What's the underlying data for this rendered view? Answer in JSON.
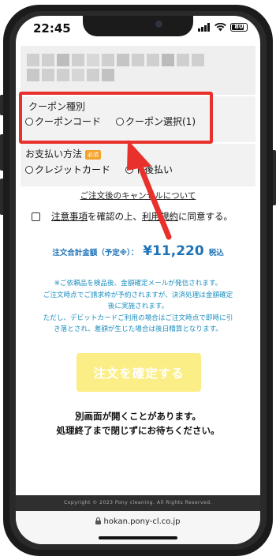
{
  "status": {
    "time": "22:45",
    "battery": "80"
  },
  "coupon": {
    "title": "クーポン種別",
    "options": [
      "クーポンコード",
      "クーポン選択(1)"
    ]
  },
  "payment": {
    "title": "お支払い方法",
    "badge": "必須",
    "options": [
      "クレジットカード",
      "後払い"
    ],
    "option2_prefix": "ト"
  },
  "cancel_link": "ご注文後のキャンセルについて",
  "agreement": {
    "link1": "注意事項",
    "text1": "を確認の上、",
    "link2": "利用規約",
    "text2": "に同意する。"
  },
  "total": {
    "label": "注文合計金額（予定※）：",
    "amount": "¥11,220",
    "tax": "税込"
  },
  "notice": [
    "※ご依頼品を検品後、金額確定メールが発信されます。",
    "ご注文時点でご請求枠が予約されますが、決済処理は金額確定",
    "後に実施されます。",
    "ただし、デビットカードご利用の場合はご注文時点で即時に引",
    "き落とされ、差額が生じた場合は後日精算となります。"
  ],
  "confirm_button": "注文を確定する",
  "popup_message": [
    "別画面が開くことがあります。",
    "処理終了まで閉じずにお待ちください。"
  ],
  "footer": "Copyright © 2023 Pony cleaning. All Rights Reserved.",
  "address": "hokan.pony-cl.co.jp",
  "colors": {
    "highlight": "#e8312c",
    "accent_blue": "#1e73b8",
    "notice_blue": "#1e8fbf",
    "button_yellow": "#fbee86",
    "badge_orange": "#f5a22a"
  }
}
